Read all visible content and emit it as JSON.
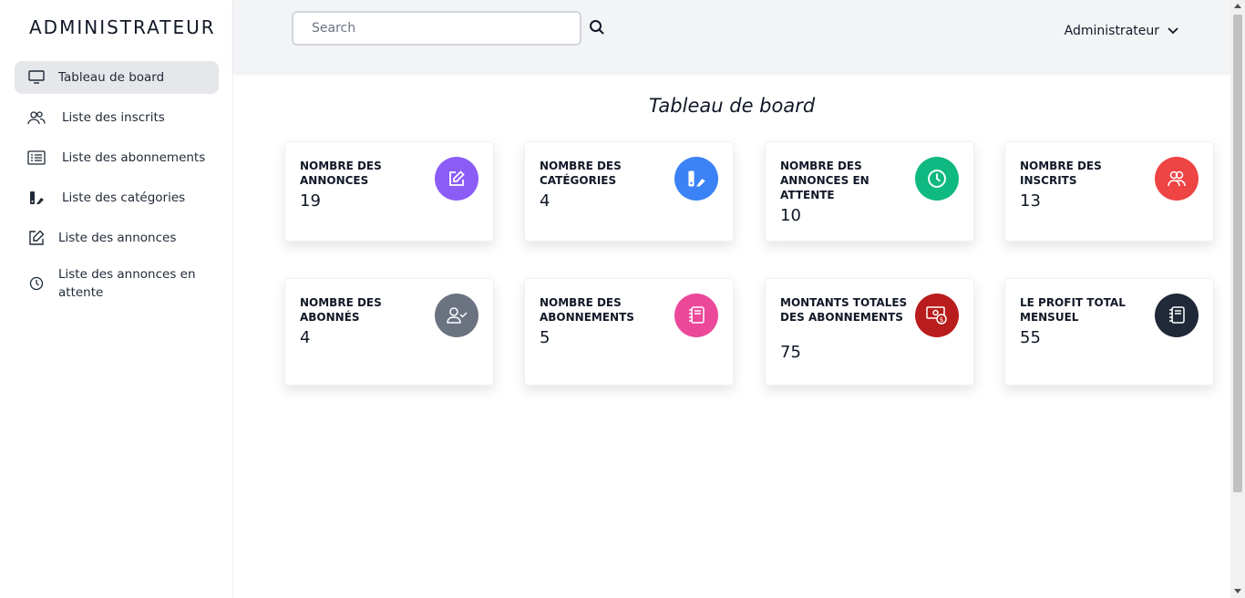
{
  "sidebar": {
    "brand": "ADMINISTRATEUR",
    "items": [
      {
        "label": "Tableau de board",
        "icon": "monitor-icon"
      },
      {
        "label": "Liste des inscrits",
        "icon": "users-icon"
      },
      {
        "label": "Liste des abonnements",
        "icon": "list-icon"
      },
      {
        "label": "Liste des catégories",
        "icon": "categories-icon"
      },
      {
        "label": "Liste des annonces",
        "icon": "edit-icon"
      },
      {
        "label": "Liste des annonces en attente",
        "icon": "clock-icon"
      }
    ]
  },
  "header": {
    "search_placeholder": "Search",
    "user_name": "Administrateur"
  },
  "main": {
    "title": "Tableau de board",
    "cards": [
      {
        "title": "NOMBRE DES ANNONCES",
        "value": "19",
        "icon": "edit-icon",
        "color": "#8b5cf6"
      },
      {
        "title": "NOMBRE DES CATÉGORIES",
        "value": "4",
        "icon": "categories-icon",
        "color": "#3b82f6"
      },
      {
        "title": "NOMBRE DES ANNONCES EN ATTENTE",
        "value": "10",
        "icon": "clock-icon",
        "color": "#10b981"
      },
      {
        "title": "NOMBRE DES INSCRITS",
        "value": "13",
        "icon": "users-icon",
        "color": "#ef4444"
      },
      {
        "title": "NOMBRE DES ABONNÉS",
        "value": "4",
        "icon": "user-check-icon",
        "color": "#6b7280"
      },
      {
        "title": "NOMBRE DES ABONNEMENTS",
        "value": "5",
        "icon": "notebook-icon",
        "color": "#ec4899"
      },
      {
        "title": "MONTANTS TOTALES DES ABONNEMENTS",
        "value": "75",
        "icon": "money-icon",
        "color": "#b91c1c"
      },
      {
        "title": "LE PROFIT TOTAL MENSUEL",
        "value": "55",
        "icon": "notebook-icon",
        "color": "#1f2937"
      }
    ]
  }
}
